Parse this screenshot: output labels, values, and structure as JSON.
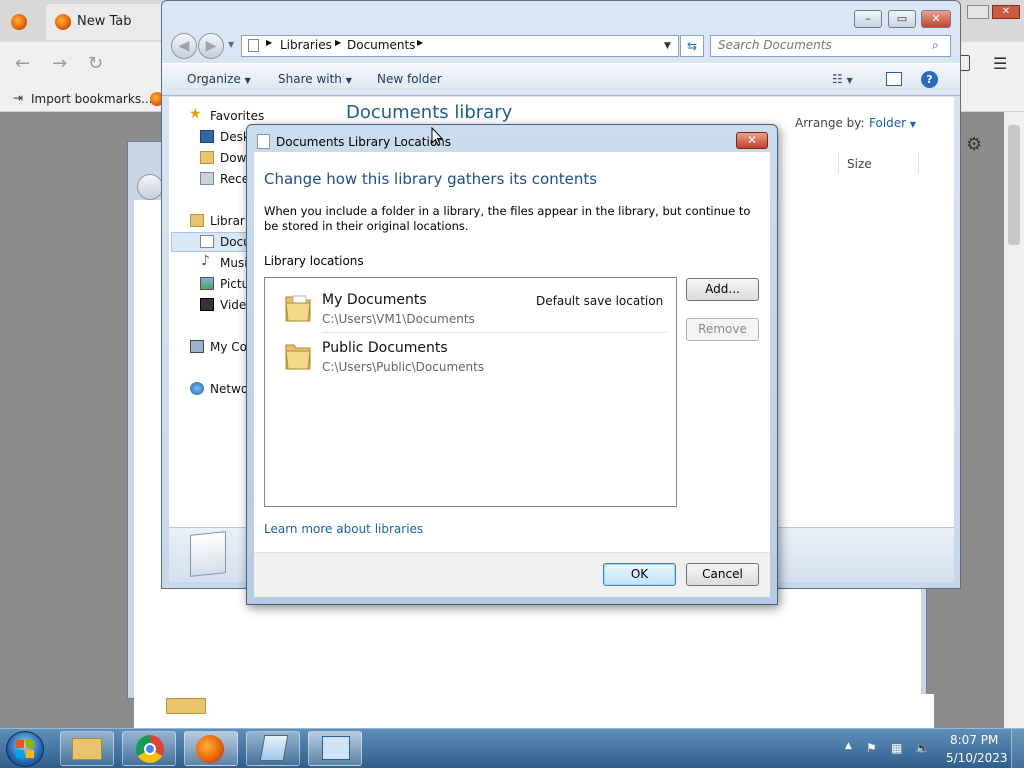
{
  "firefox": {
    "tab_title": "New Tab",
    "bookmark_label": "Import bookmarks..."
  },
  "explorer": {
    "breadcrumb": [
      "Libraries",
      "Documents"
    ],
    "search_placeholder": "Search Documents",
    "commands": {
      "organize": "Organize",
      "share_with": "Share with",
      "new_folder": "New folder"
    },
    "nav": {
      "favorites": "Favorites",
      "desktop": "Desk",
      "downloads": "Dowr",
      "recent": "Rece",
      "libraries": "Librarie",
      "documents": "Docu",
      "music": "Musi",
      "pictures": "Pictu",
      "videos": "Videc",
      "computer": "My Co",
      "network": "Netwo"
    },
    "library_title": "Documents library",
    "arrange_by_label": "Arrange by:",
    "arrange_by_value": "Folder",
    "column_size": "Size"
  },
  "dialog": {
    "title": "Documents Library Locations",
    "heading": "Change how this library gathers its contents",
    "description": "When you include a folder in a library, the files appear in the library, but continue to be stored in their original locations.",
    "locations_label": "Library locations",
    "locations": [
      {
        "name": "My Documents",
        "path": "C:\\Users\\VM1\\Documents",
        "tag": "Default save location"
      },
      {
        "name": "Public Documents",
        "path": "C:\\Users\\Public\\Documents",
        "tag": ""
      }
    ],
    "add_button": "Add...",
    "remove_button": "Remove",
    "learn_more": "Learn more about libraries",
    "ok_button": "OK",
    "cancel_button": "Cancel"
  },
  "taskbar": {
    "time": "8:07 PM",
    "date": "5/10/2023"
  }
}
